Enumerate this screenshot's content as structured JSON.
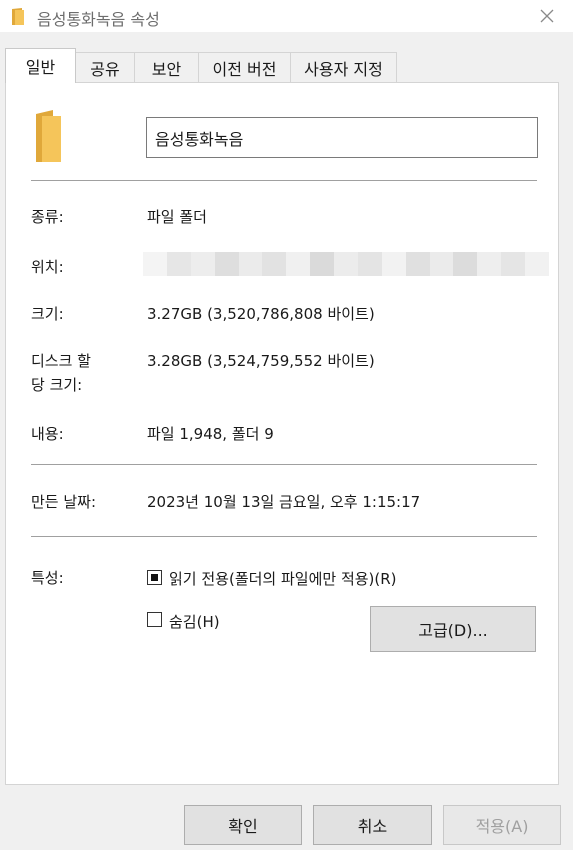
{
  "window": {
    "title": "음성통화녹음 속성",
    "close_icon": "close-icon"
  },
  "tabs": [
    "일반",
    "공유",
    "보안",
    "이전 버전",
    "사용자 지정"
  ],
  "general": {
    "name_value": "음성통화녹음",
    "type_label": "종류:",
    "type_value": "파일 폴더",
    "location_label": "위치:",
    "size_label": "크기:",
    "size_value": "3.27GB (3,520,786,808 바이트)",
    "size_on_disk_label_line1": "디스크 할",
    "size_on_disk_label_line2": "당 크기:",
    "size_on_disk_value": "3.28GB (3,524,759,552 바이트)",
    "contains_label": "내용:",
    "contains_value": "파일 1,948, 폴더 9",
    "created_label": "만든 날짜:",
    "created_value": "2023년 10월 13일 금요일, 오후 1:15:17",
    "attributes_label": "특성:",
    "readonly_label": "읽기 전용(폴더의 파일에만 적용)(R)",
    "hidden_label": "숨김(H)",
    "advanced_button": "고급(D)..."
  },
  "footer": {
    "ok": "확인",
    "cancel": "취소",
    "apply": "적용(A)"
  },
  "colors": {
    "folder": "#f5c55a",
    "folder_dark": "#e0a83a",
    "panel": "#ffffff",
    "window_bg": "#f0f0f0"
  }
}
